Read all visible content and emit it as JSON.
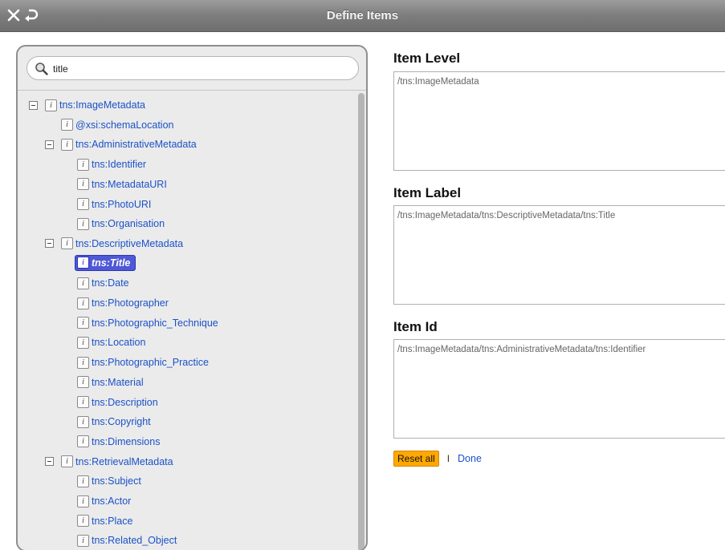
{
  "window": {
    "title": "Define Items"
  },
  "icons": {
    "close": "close-icon",
    "back": "back-arrow-icon",
    "search": "search-icon",
    "info": "info-icon",
    "collapse": "collapse-icon"
  },
  "search": {
    "value": "title"
  },
  "tree": [
    {
      "label": "tns:ImageMetadata",
      "toggle": true,
      "level": 0
    },
    {
      "label": "@xsi:schemaLocation",
      "toggle": false,
      "level": 1
    },
    {
      "label": "tns:AdministrativeMetadata",
      "toggle": true,
      "level": 1
    },
    {
      "label": "tns:Identifier",
      "toggle": false,
      "level": 2
    },
    {
      "label": "tns:MetadataURI",
      "toggle": false,
      "level": 2
    },
    {
      "label": "tns:PhotoURI",
      "toggle": false,
      "level": 2
    },
    {
      "label": "tns:Organisation",
      "toggle": false,
      "level": 2
    },
    {
      "label": "tns:DescriptiveMetadata",
      "toggle": true,
      "level": 1
    },
    {
      "label": "tns:Title",
      "toggle": false,
      "level": 2,
      "selected": true
    },
    {
      "label": "tns:Date",
      "toggle": false,
      "level": 2
    },
    {
      "label": "tns:Photographer",
      "toggle": false,
      "level": 2
    },
    {
      "label": "tns:Photographic_Technique",
      "toggle": false,
      "level": 2
    },
    {
      "label": "tns:Location",
      "toggle": false,
      "level": 2
    },
    {
      "label": "tns:Photographic_Practice",
      "toggle": false,
      "level": 2
    },
    {
      "label": "tns:Material",
      "toggle": false,
      "level": 2
    },
    {
      "label": "tns:Description",
      "toggle": false,
      "level": 2
    },
    {
      "label": "tns:Copyright",
      "toggle": false,
      "level": 2
    },
    {
      "label": "tns:Dimensions",
      "toggle": false,
      "level": 2
    },
    {
      "label": "tns:RetrievalMetadata",
      "toggle": true,
      "level": 1
    },
    {
      "label": "tns:Subject",
      "toggle": false,
      "level": 2
    },
    {
      "label": "tns:Actor",
      "toggle": false,
      "level": 2
    },
    {
      "label": "tns:Place",
      "toggle": false,
      "level": 2
    },
    {
      "label": "tns:Related_Object",
      "toggle": false,
      "level": 2
    }
  ],
  "form": {
    "item_level": {
      "title": "Item Level",
      "value": "/tns:ImageMetadata"
    },
    "item_label": {
      "title": "Item Label",
      "value": "/tns:ImageMetadata/tns:DescriptiveMetadata/tns:Title"
    },
    "item_id": {
      "title": "Item Id",
      "value": "/tns:ImageMetadata/tns:AdministrativeMetadata/tns:Identifier"
    }
  },
  "actions": {
    "reset_label": "Reset all",
    "separator": "I",
    "done_label": "Done"
  },
  "colors": {
    "link": "#1b52c7",
    "selection": "#4f58d6",
    "reset_button": "#ffa800"
  }
}
